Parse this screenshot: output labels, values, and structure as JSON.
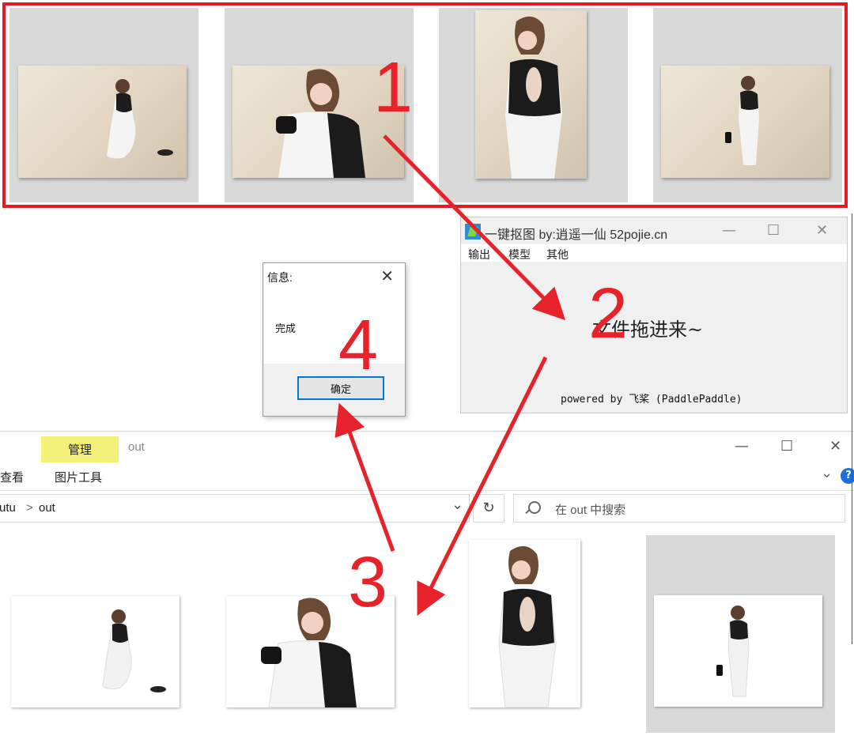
{
  "step_numbers": [
    "1",
    "2",
    "3",
    "4"
  ],
  "app_window": {
    "title": "一键抠图  by:逍遥一仙 52pojie.cn",
    "menu": [
      "输出",
      "模型",
      "其他"
    ],
    "drop_hint": "文件拖进来~",
    "powered_by": "powered by 飞桨 (PaddlePaddle)",
    "minimize": "—",
    "maximize": "☐",
    "close": "✕"
  },
  "dialog": {
    "title": "信息:",
    "close": "✕",
    "message": "完成",
    "ok_label": "确定"
  },
  "explorer": {
    "manage_tab": "管理",
    "title": "out",
    "ribbon": [
      "查看",
      "图片工具"
    ],
    "minimize": "—",
    "maximize": "☐",
    "close": "✕",
    "help": "?",
    "breadcrumb": [
      "utu",
      "out"
    ],
    "breadcrumb_sep": ">",
    "dropdown": "⌄",
    "refresh": "↻",
    "expand": "⌄",
    "search_placeholder": "在 out 中搜索"
  },
  "colors": {
    "annotation_red": "#e31b23",
    "tile_gray": "#d9d9d9",
    "manage_tab_yellow": "#f4f07a",
    "dialog_button_border": "#0078d7"
  },
  "icons": {
    "app_logo": "koutu-app-icon",
    "search": "search-icon",
    "refresh": "refresh-icon",
    "help": "help-icon"
  }
}
